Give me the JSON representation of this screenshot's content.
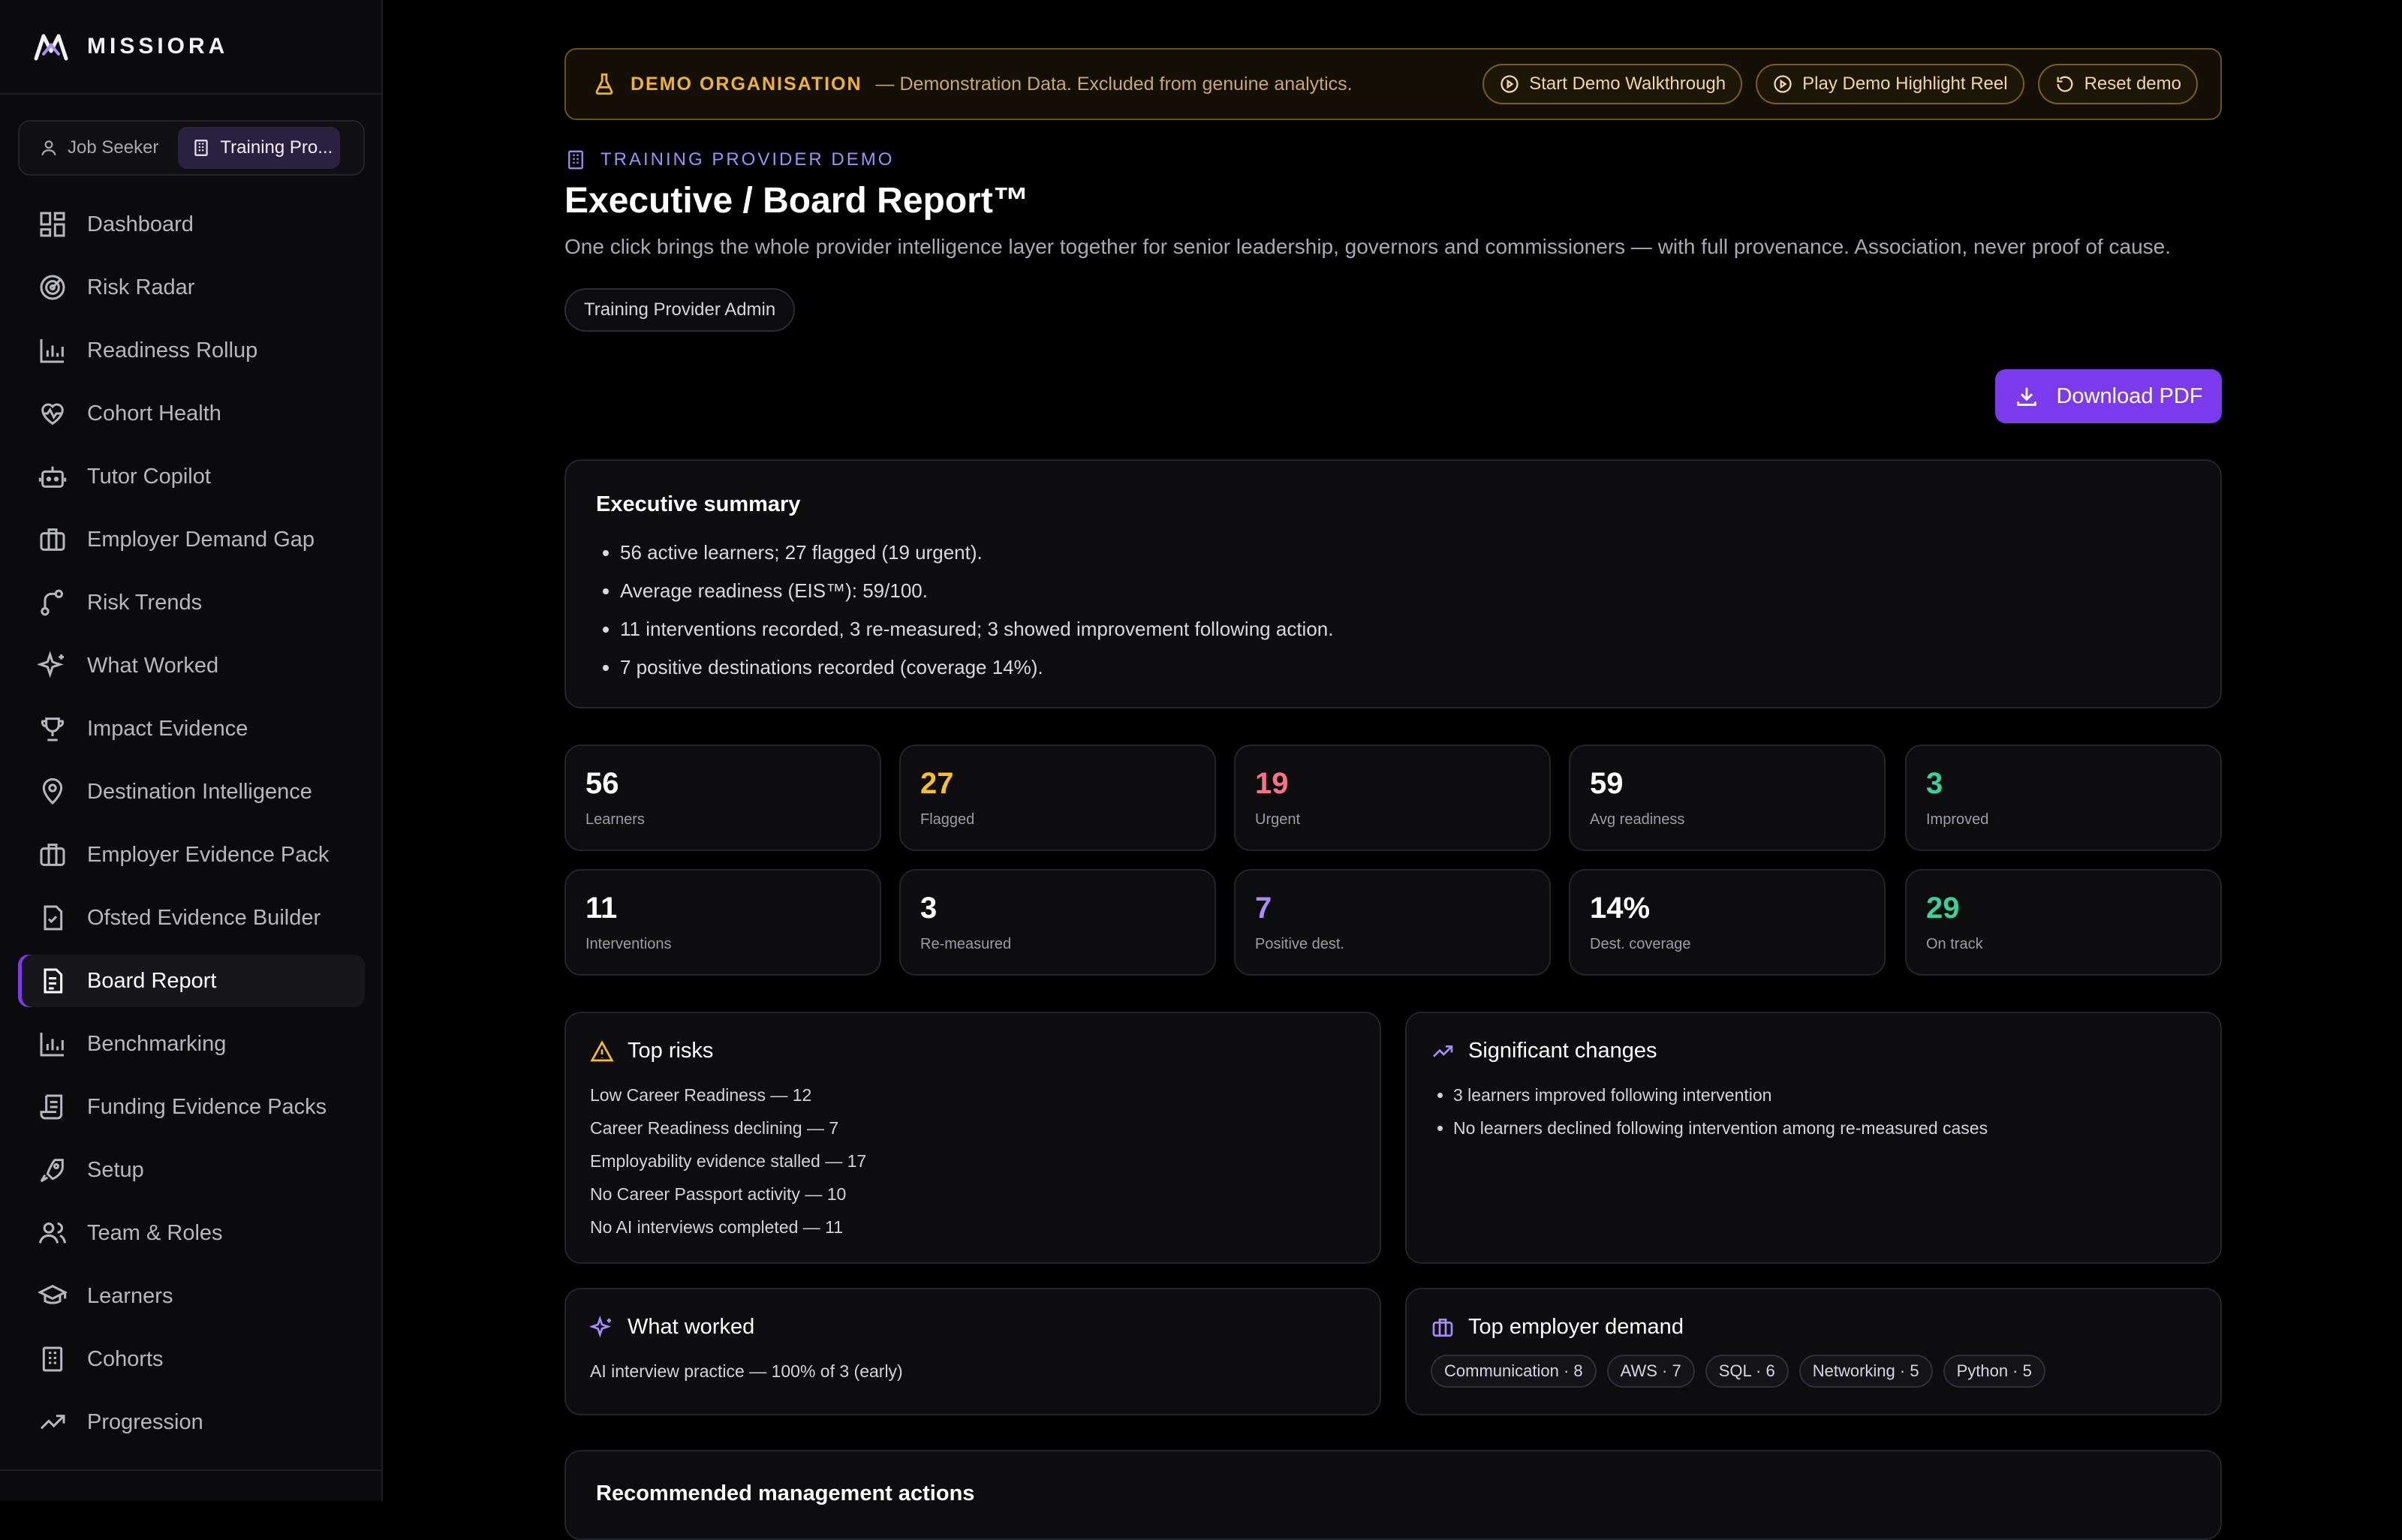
{
  "brand": {
    "name": "MISSIORA"
  },
  "role_switch": {
    "job_seeker": "Job Seeker",
    "training_provider": "Training Pro..."
  },
  "nav": [
    {
      "label": "Dashboard",
      "icon": "dashboard-icon"
    },
    {
      "label": "Risk Radar",
      "icon": "radar-icon"
    },
    {
      "label": "Readiness Rollup",
      "icon": "bar-chart-icon"
    },
    {
      "label": "Cohort Health",
      "icon": "heart-pulse-icon"
    },
    {
      "label": "Tutor Copilot",
      "icon": "robot-icon"
    },
    {
      "label": "Employer Demand Gap",
      "icon": "briefcase-icon"
    },
    {
      "label": "Risk Trends",
      "icon": "git-branch-icon"
    },
    {
      "label": "What Worked",
      "icon": "sparkles-icon"
    },
    {
      "label": "Impact Evidence",
      "icon": "trophy-icon"
    },
    {
      "label": "Destination Intelligence",
      "icon": "map-pin-icon"
    },
    {
      "label": "Employer Evidence Pack",
      "icon": "briefcase-icon"
    },
    {
      "label": "Ofsted Evidence Builder",
      "icon": "file-check-icon"
    },
    {
      "label": "Board Report",
      "icon": "file-text-icon",
      "active": true
    },
    {
      "label": "Benchmarking",
      "icon": "bar-chart-icon"
    },
    {
      "label": "Funding Evidence Packs",
      "icon": "scroll-icon"
    },
    {
      "label": "Setup",
      "icon": "rocket-icon"
    },
    {
      "label": "Team & Roles",
      "icon": "users-icon"
    },
    {
      "label": "Learners",
      "icon": "graduation-cap-icon"
    },
    {
      "label": "Cohorts",
      "icon": "building-icon"
    },
    {
      "label": "Progression",
      "icon": "trending-up-icon"
    }
  ],
  "banner": {
    "title": "DEMO ORGANISATION",
    "desc": "— Demonstration Data. Excluded from genuine analytics.",
    "walkthrough": "Start Demo Walkthrough",
    "highlight": "Play Demo Highlight Reel",
    "reset": "Reset demo"
  },
  "header": {
    "eyebrow": "TRAINING PROVIDER DEMO",
    "title": "Executive / Board Report™",
    "subtitle": "One click brings the whole provider intelligence layer together for senior leadership, governors and commissioners — with full provenance. Association, never proof of cause.",
    "role_chip": "Training Provider Admin",
    "download": "Download PDF"
  },
  "summary": {
    "title": "Executive summary",
    "bullets": [
      "56 active learners; 27 flagged (19 urgent).",
      "Average readiness (EIS™): 59/100.",
      "11 interventions recorded, 3 re-measured; 3 showed improvement following action.",
      "7 positive destinations recorded (coverage 14%)."
    ]
  },
  "stats": [
    {
      "value": "56",
      "label": "Learners",
      "color": "#ffffff"
    },
    {
      "value": "27",
      "label": "Flagged",
      "color": "#fbbf24"
    },
    {
      "value": "19",
      "label": "Urgent",
      "color": "#fb7185"
    },
    {
      "value": "59",
      "label": "Avg readiness",
      "color": "#ffffff"
    },
    {
      "value": "3",
      "label": "Improved",
      "color": "#34d399"
    },
    {
      "value": "11",
      "label": "Interventions",
      "color": "#ffffff"
    },
    {
      "value": "3",
      "label": "Re-measured",
      "color": "#ffffff"
    },
    {
      "value": "7",
      "label": "Positive dest.",
      "color": "#a78bfa"
    },
    {
      "value": "14%",
      "label": "Dest. coverage",
      "color": "#ffffff"
    },
    {
      "value": "29",
      "label": "On track",
      "color": "#34d399"
    }
  ],
  "top_risks": {
    "title": "Top risks",
    "items": [
      "Low Career Readiness — 12",
      "Career Readiness declining — 7",
      "Employability evidence stalled — 17",
      "No Career Passport activity — 10",
      "No AI interviews completed — 11"
    ]
  },
  "changes": {
    "title": "Significant changes",
    "items": [
      "3 learners improved following intervention",
      "No learners declined following intervention among re-measured cases"
    ]
  },
  "what_worked": {
    "title": "What worked",
    "item": "AI interview practice — 100% of 3 (early)"
  },
  "demand": {
    "title": "Top employer demand",
    "tags": [
      "Communication · 8",
      "AWS · 7",
      "SQL · 6",
      "Networking · 5",
      "Python · 5"
    ]
  },
  "actions": {
    "title": "Recommended management actions"
  },
  "colors": {
    "accent": "#7c3aed",
    "warning": "#f0b429"
  }
}
